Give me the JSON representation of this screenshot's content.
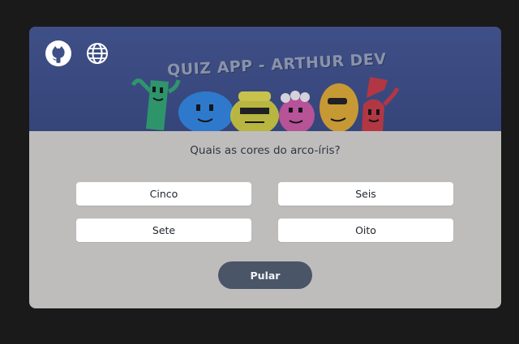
{
  "header": {
    "github_icon": "github-icon",
    "language_icon": "globe-icon",
    "banner_title": "QUIZ APP - ARTHUR DEV"
  },
  "quiz": {
    "question": "Quais as cores do arco-íris?",
    "answers": [
      "Cinco",
      "Seis",
      "Sete",
      "Oito"
    ],
    "skip_label": "Pular"
  },
  "colors": {
    "page_background": "#1a1a1a",
    "card_background": "#bebdbc",
    "banner_background": "#3f4f87",
    "answer_background": "#ffffff",
    "skip_button": "#4a5568"
  }
}
